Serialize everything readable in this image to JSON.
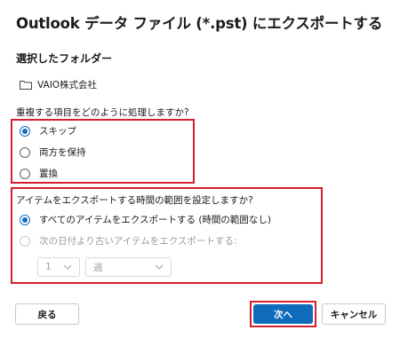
{
  "dialog": {
    "title": "Outlook データ ファイル (*.pst) にエクスポートする"
  },
  "folder_section": {
    "heading": "選択したフォルダー",
    "folder_name": "VAIO株式会社",
    "icon": "folder-icon"
  },
  "duplicates": {
    "question": "重複する項目をどのように処理しますか?",
    "options": [
      {
        "label": "スキップ",
        "selected": true
      },
      {
        "label": "両方を保持",
        "selected": false
      },
      {
        "label": "置換",
        "selected": false
      }
    ]
  },
  "time_range": {
    "question": "アイテムをエクスポートする時間の範囲を設定しますか?",
    "options": [
      {
        "label": "すべてのアイテムをエクスポートする (時間の範囲なし)",
        "selected": true,
        "enabled": true
      },
      {
        "label": "次の日付より古いアイテムをエクスポートする:",
        "selected": false,
        "enabled": false
      }
    ],
    "amount_value": "1",
    "unit_value": "週"
  },
  "buttons": {
    "back": "戻る",
    "next": "次へ",
    "cancel": "キャンセル"
  },
  "colors": {
    "accent": "#0f6cbd",
    "highlight_border": "#d4202c"
  }
}
